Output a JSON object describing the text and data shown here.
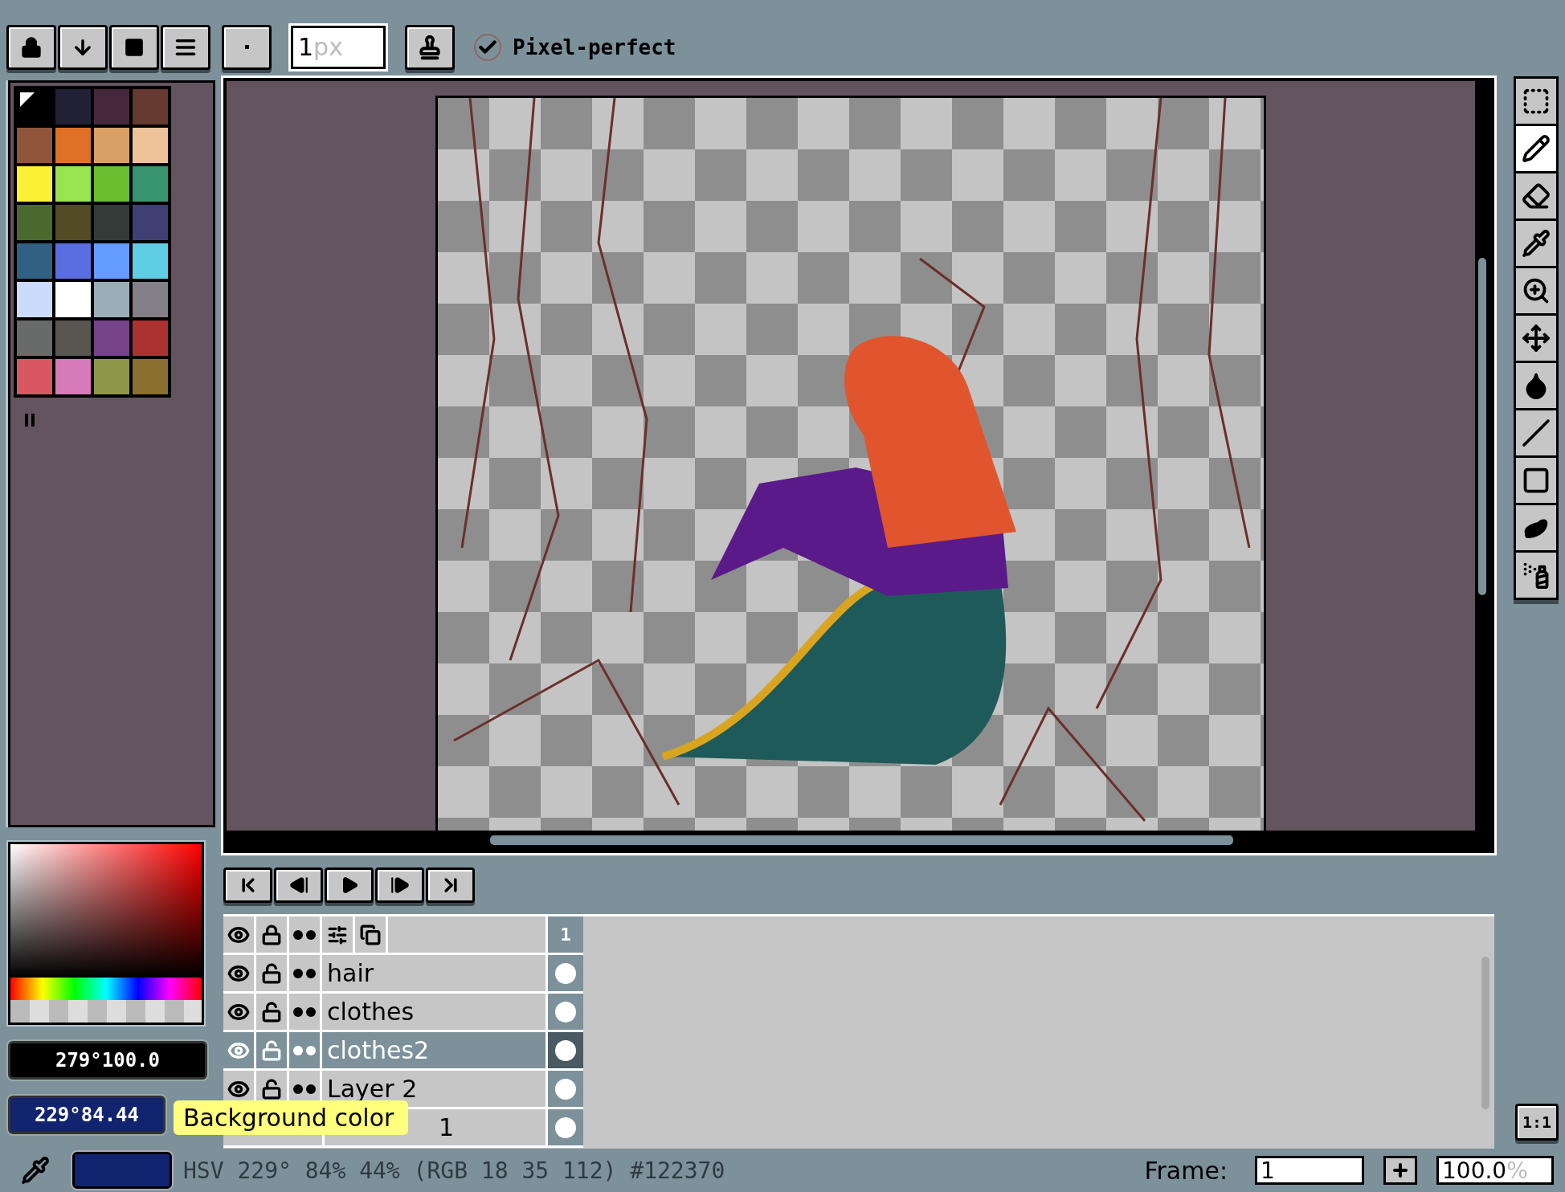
{
  "toolbar": {
    "brush_size": {
      "value": "1",
      "unit": "px"
    },
    "pixel_perfect": {
      "label": "Pixel-perfect",
      "checked": true
    }
  },
  "palette": [
    {
      "color": "#000000",
      "selected": true
    },
    {
      "color": "#222034",
      "selected": false
    },
    {
      "color": "#45283c",
      "selected": false
    },
    {
      "color": "#663931",
      "selected": false
    },
    {
      "color": "#8f563b",
      "selected": false
    },
    {
      "color": "#df7126",
      "selected": false
    },
    {
      "color": "#d9a066",
      "selected": false
    },
    {
      "color": "#eec39a",
      "selected": false
    },
    {
      "color": "#fbf236",
      "selected": false
    },
    {
      "color": "#99e550",
      "selected": false
    },
    {
      "color": "#6abe30",
      "selected": false
    },
    {
      "color": "#37946e",
      "selected": false
    },
    {
      "color": "#4b692f",
      "selected": false
    },
    {
      "color": "#524b24",
      "selected": false
    },
    {
      "color": "#323c39",
      "selected": false
    },
    {
      "color": "#3f3f74",
      "selected": false
    },
    {
      "color": "#306082",
      "selected": false
    },
    {
      "color": "#5b6ee1",
      "selected": false
    },
    {
      "color": "#639bff",
      "selected": false
    },
    {
      "color": "#5fcde4",
      "selected": false
    },
    {
      "color": "#cbdbfc",
      "selected": false
    },
    {
      "color": "#ffffff",
      "selected": false
    },
    {
      "color": "#9badb7",
      "selected": false
    },
    {
      "color": "#847e87",
      "selected": false
    },
    {
      "color": "#696a6a",
      "selected": false
    },
    {
      "color": "#595652",
      "selected": false
    },
    {
      "color": "#76428a",
      "selected": false
    },
    {
      "color": "#ac3232",
      "selected": false
    },
    {
      "color": "#d95763",
      "selected": false
    },
    {
      "color": "#d77bba",
      "selected": false
    },
    {
      "color": "#8f974a",
      "selected": false
    },
    {
      "color": "#8a6f30",
      "selected": false
    }
  ],
  "foreground_value": "279°100.0",
  "background_value": "229°84.44",
  "tooltip": "Background color",
  "tools": [
    {
      "kind": "marquee",
      "selected": false
    },
    {
      "kind": "pencil",
      "selected": true
    },
    {
      "kind": "eraser",
      "selected": false
    },
    {
      "kind": "eyedropper",
      "selected": false
    },
    {
      "kind": "zoom",
      "selected": false
    },
    {
      "kind": "move",
      "selected": false
    },
    {
      "kind": "fill",
      "selected": false
    },
    {
      "kind": "line",
      "selected": false
    },
    {
      "kind": "rectangle",
      "selected": false
    },
    {
      "kind": "blob",
      "selected": false
    },
    {
      "kind": "spray",
      "selected": false
    }
  ],
  "zoom_reset": "1:1",
  "timeline": {
    "frame_header": "1",
    "layers": [
      {
        "kind": "layer",
        "name": "hair",
        "selected": false
      },
      {
        "kind": "layer",
        "name": "clothes",
        "selected": false
      },
      {
        "kind": "layer",
        "name": "clothes2",
        "selected": true
      },
      {
        "kind": "layer",
        "name": "Layer 2",
        "selected": false
      },
      {
        "kind": "covered",
        "name": "1",
        "selected": false
      }
    ]
  },
  "status_bar": {
    "color_info": "HSV 229° 84% 44% (RGB 18 35 112) #122370",
    "frame_label": "Frame:",
    "frame": "1",
    "zoom": "100.0",
    "zoom_unit": "%"
  }
}
